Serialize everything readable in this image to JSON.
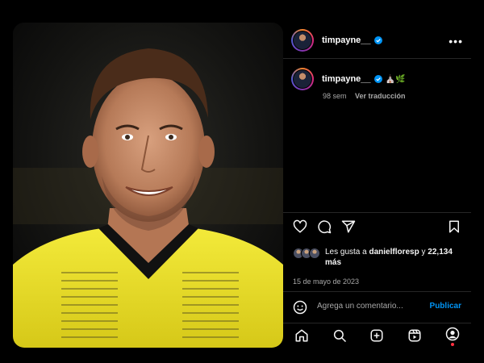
{
  "post": {
    "username": "timpayne__",
    "caption_emojis": "⛪🌿",
    "time_ago": "98 sem",
    "translate_label": "Ver traducción",
    "likes_prefix": "Les gusta a ",
    "likes_user": "danielfloresp",
    "likes_connector": " y ",
    "likes_count": "22,134 más",
    "date": "15 de mayo de 2023"
  },
  "comment": {
    "placeholder": "Agrega un comentario...",
    "publish_label": "Publicar"
  },
  "colors": {
    "accent": "#0095f6",
    "verified": "#0095f6",
    "jersey": "#f1e82a"
  },
  "icons": {
    "actions": [
      "heart-icon",
      "comment-icon",
      "share-icon",
      "bookmark-icon"
    ],
    "nav": [
      "home-icon",
      "search-icon",
      "create-icon",
      "reels-icon",
      "profile-icon"
    ]
  }
}
